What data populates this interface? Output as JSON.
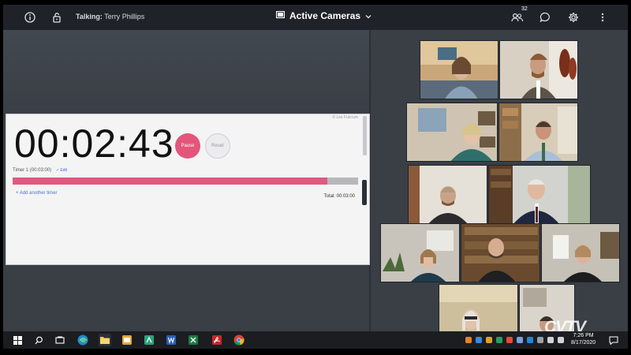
{
  "topbar": {
    "talking_prefix": "Talking:",
    "talking_name": "Terry Phillips",
    "view_title": "Active Cameras",
    "participant_count": "32",
    "icons": [
      "info-icon",
      "lock-open-icon",
      "screen-icon",
      "chevron-down-icon",
      "participants-icon",
      "chat-icon",
      "settings-icon",
      "more-vertical-icon"
    ]
  },
  "timer": {
    "author": "© Les Fulcrum",
    "display": "00:02:43",
    "pause_label": "Pause",
    "reset_label": "Reset",
    "timer_name": "Timer 1 (00:03:00)",
    "edit_label": "✓ Edit",
    "progress": 0.91,
    "add_label": "+ Add another timer",
    "total_label": "Total: 00:03:00",
    "accent": "#df5a7e"
  },
  "gallery": {
    "tile_count": 13
  },
  "watermark": "CVTV",
  "taskbar": {
    "time": "7:26 PM",
    "date": "8/17/2020",
    "apps": [
      "windows-start",
      "search",
      "task-view",
      "edge",
      "file-explorer",
      "outlook",
      "sway",
      "word",
      "excel",
      "acrobat",
      "chrome"
    ]
  }
}
